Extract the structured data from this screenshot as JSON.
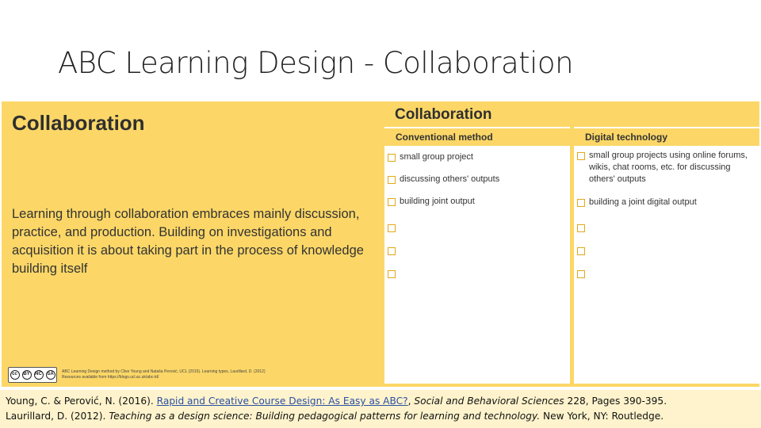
{
  "slide": {
    "title": "ABC Learning Design - Collaboration"
  },
  "left": {
    "heading": "Collaboration",
    "body": "Learning through collaboration embraces mainly discussion, practice, and production. Building on investigations and acquisition it is about taking part in the process of knowledge building itself",
    "credit_line1": "ABC Learning Design method by Clive Young and Nataša Perović, UCL (2015). Learning types, Laurillard, D. (2012)",
    "credit_line2": "Resources available from https://blogs.ucl.ac.uk/abc-ld/",
    "cc_badge": [
      "cc",
      "BY",
      "NC",
      "SA"
    ]
  },
  "right": {
    "heading": "Collaboration",
    "conventional": {
      "header": "Conventional method",
      "items": [
        "small group project",
        "discussing others' outputs",
        "building joint output",
        "",
        "",
        ""
      ]
    },
    "digital": {
      "header": "Digital technology",
      "items": [
        "small group projects using online forums, wikis, chat rooms, etc. for discussing others' outputs",
        "building a joint digital output",
        "",
        "",
        ""
      ]
    }
  },
  "references": {
    "ref1_authors": "Young, C. & Perović, N. (2016). ",
    "ref1_link": "Rapid and Creative Course Design: As Easy as ABC?",
    "ref1_sep": ", ",
    "ref1_journal": "Social and Behavioral Sciences",
    "ref1_tail": " 228, Pages 390-395.",
    "ref2_authors": "Laurillard, D. (2012). ",
    "ref2_title": "Teaching as a design science: Building pedagogical patterns for learning and technology.",
    "ref2_tail": " New York, NY: Routledge."
  }
}
